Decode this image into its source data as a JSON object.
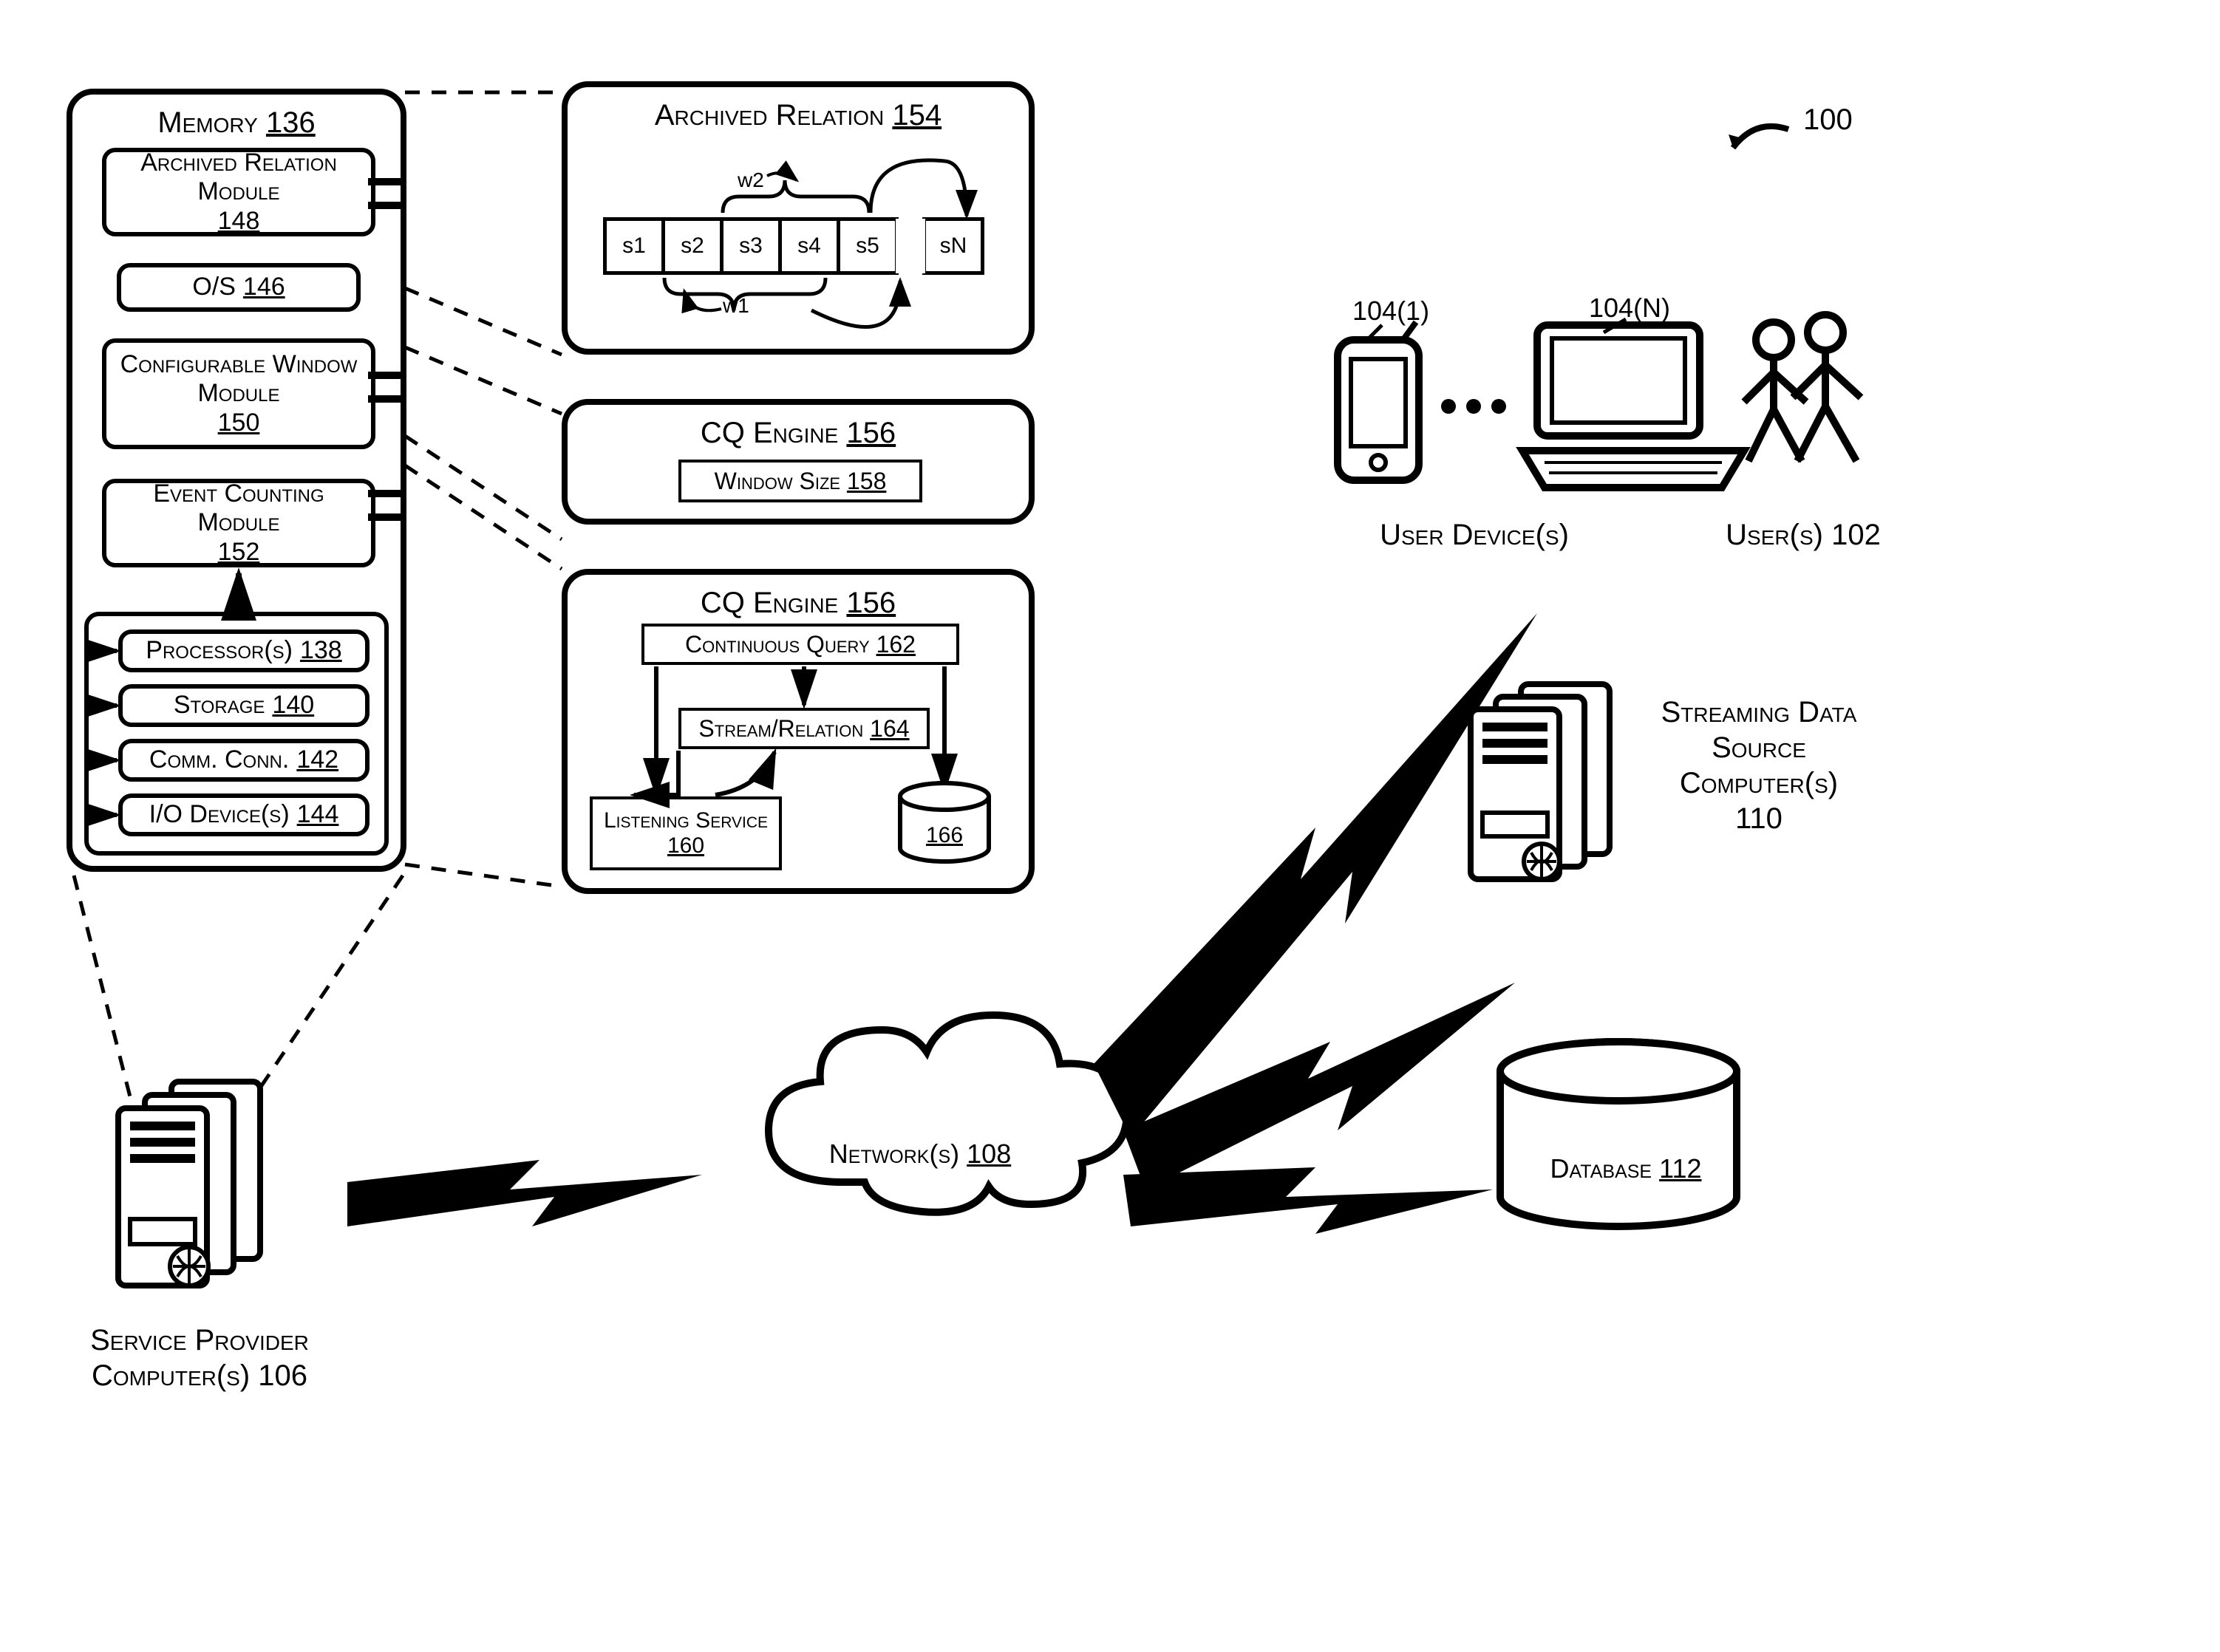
{
  "figureRef": "100",
  "memory": {
    "title": "Memory",
    "num": "136",
    "modules": {
      "archivedRelationModule": {
        "label": "Archived Relation Module",
        "num": "148"
      },
      "os": {
        "label": "O/S",
        "num": "146"
      },
      "configWindow": {
        "label": "Configurable Window Module",
        "num": "150"
      },
      "eventCounting": {
        "label": "Event Counting Module",
        "num": "152"
      }
    },
    "hw": {
      "processors": {
        "label": "Processor(s)",
        "num": "138"
      },
      "storage": {
        "label": "Storage",
        "num": "140"
      },
      "comm": {
        "label": "Comm. Conn.",
        "num": "142"
      },
      "io": {
        "label": "I/O Device(s)",
        "num": "144"
      }
    }
  },
  "archivedRelation": {
    "title": "Archived Relation",
    "num": "154",
    "cells": [
      "s1",
      "s2",
      "s3",
      "s4",
      "s5",
      "sN"
    ],
    "w1": "w1",
    "w2": "w2"
  },
  "cqEngine1": {
    "title": "CQ Engine",
    "num": "156",
    "windowSize": {
      "label": "Window Size",
      "num": "158"
    }
  },
  "cqEngine2": {
    "title": "CQ Engine",
    "num": "156",
    "continuousQuery": {
      "label": "Continuous Query",
      "num": "162"
    },
    "streamRelation": {
      "label": "Stream/Relation",
      "num": "164"
    },
    "listening": {
      "label": "Listening Service",
      "num": "160"
    },
    "dbNum": "166"
  },
  "serviceProvider": {
    "label": "Service Provider Computer(s)",
    "num": "106"
  },
  "network": {
    "label": "Network(s)",
    "num": "108"
  },
  "userDevices": {
    "label": "User Device(s)",
    "phone": "104(1)",
    "laptop": "104(N)"
  },
  "users": {
    "label": "User(s)",
    "num": "102"
  },
  "streamingSource": {
    "label": "Streaming Data Source Computer(s)",
    "num": "110"
  },
  "database": {
    "label": "Database",
    "num": "112"
  }
}
